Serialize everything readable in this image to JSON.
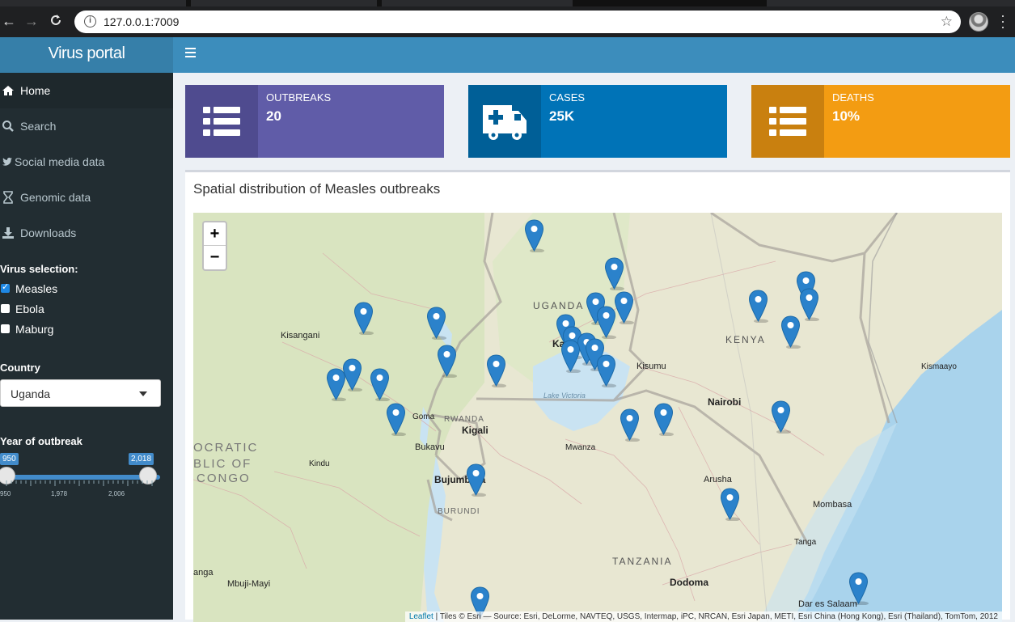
{
  "browser": {
    "url": "127.0.0.1:7009",
    "back_icon": "arrow-left-icon",
    "forward_icon": "arrow-right-icon",
    "reload_icon": "reload-icon"
  },
  "app": {
    "title": "Virus portal"
  },
  "sidebar": {
    "items": [
      {
        "label": "Home",
        "icon": "home-icon"
      },
      {
        "label": "Search",
        "icon": "search-icon"
      },
      {
        "label": "Social media data",
        "icon": "twitter-icon"
      },
      {
        "label": "Genomic data",
        "icon": "hourglass-icon"
      },
      {
        "label": "Downloads",
        "icon": "download-icon"
      }
    ],
    "virus_selection": {
      "heading": "Virus selection:",
      "options": [
        {
          "label": "Measles",
          "checked": true
        },
        {
          "label": "Ebola",
          "checked": false
        },
        {
          "label": "Maburg",
          "checked": false
        }
      ]
    },
    "country": {
      "heading": "Country",
      "selected": "Uganda"
    },
    "year": {
      "heading": "Year of outbreak",
      "min_label": "950",
      "max_label": "2,018",
      "ticks": [
        "950",
        "1,978",
        "2,006"
      ]
    }
  },
  "value_boxes": [
    {
      "title": "OUTBREAKS",
      "value": "20",
      "color": "#605ca8",
      "icon_bg": "#4f4b8f",
      "icon": "list-icon"
    },
    {
      "title": "CASES",
      "value": "25K",
      "color": "#0073b7",
      "icon_bg": "#005f97",
      "icon": "ambulance-icon"
    },
    {
      "title": "DEATHS",
      "value": "10%",
      "color": "#f39c12",
      "icon_bg": "#c9800f",
      "icon": "list-icon"
    }
  ],
  "map": {
    "title": "Spatial distribution of Measles outbreaks",
    "zoom_in": "+",
    "zoom_out": "−",
    "attribution_link": "Leaflet",
    "attribution_text": " | Tiles © Esri — Source: Esri, DeLorme, NAVTEQ, USGS, Intermap, iPC, NRCAN, Esri Japan, METI, Esri China (Hong Kong), Esri (Thailand), TomTom, 2012",
    "labels": {
      "uganda": "UGANDA",
      "kenya": "KENYA",
      "rwanda": "RWANDA",
      "burundi": "BURUNDI",
      "tanzania": "TANZANIA",
      "drc1": "OCRATIC",
      "drc2": "BLIC OF",
      "drc3": "CONGO",
      "kisangani": "Kisangani",
      "kampala": "Ka",
      "kisumu": "Kisumu",
      "nairobi": "Nairobi",
      "kismaayo": "Kismaayo",
      "goma": "Goma",
      "kigali": "Kigali",
      "bukavu": "Bukavu",
      "kindu": "Kindu",
      "mwanza": "Mwanza",
      "bujumbura": "Bujumbura",
      "arusha": "Arusha",
      "mombasa": "Mombasa",
      "tanga": "Tanga",
      "dodoma": "Dodoma",
      "mbuji_mayi": "Mbuji-Mayi",
      "anga": "anga",
      "dar": "Dar es Salaam",
      "lake_victoria": "Lake Victoria"
    }
  },
  "colors": {
    "header": "#3c8dbc",
    "logo": "#367fa9",
    "sidebar": "#222d32",
    "marker": "#2b82cb"
  }
}
